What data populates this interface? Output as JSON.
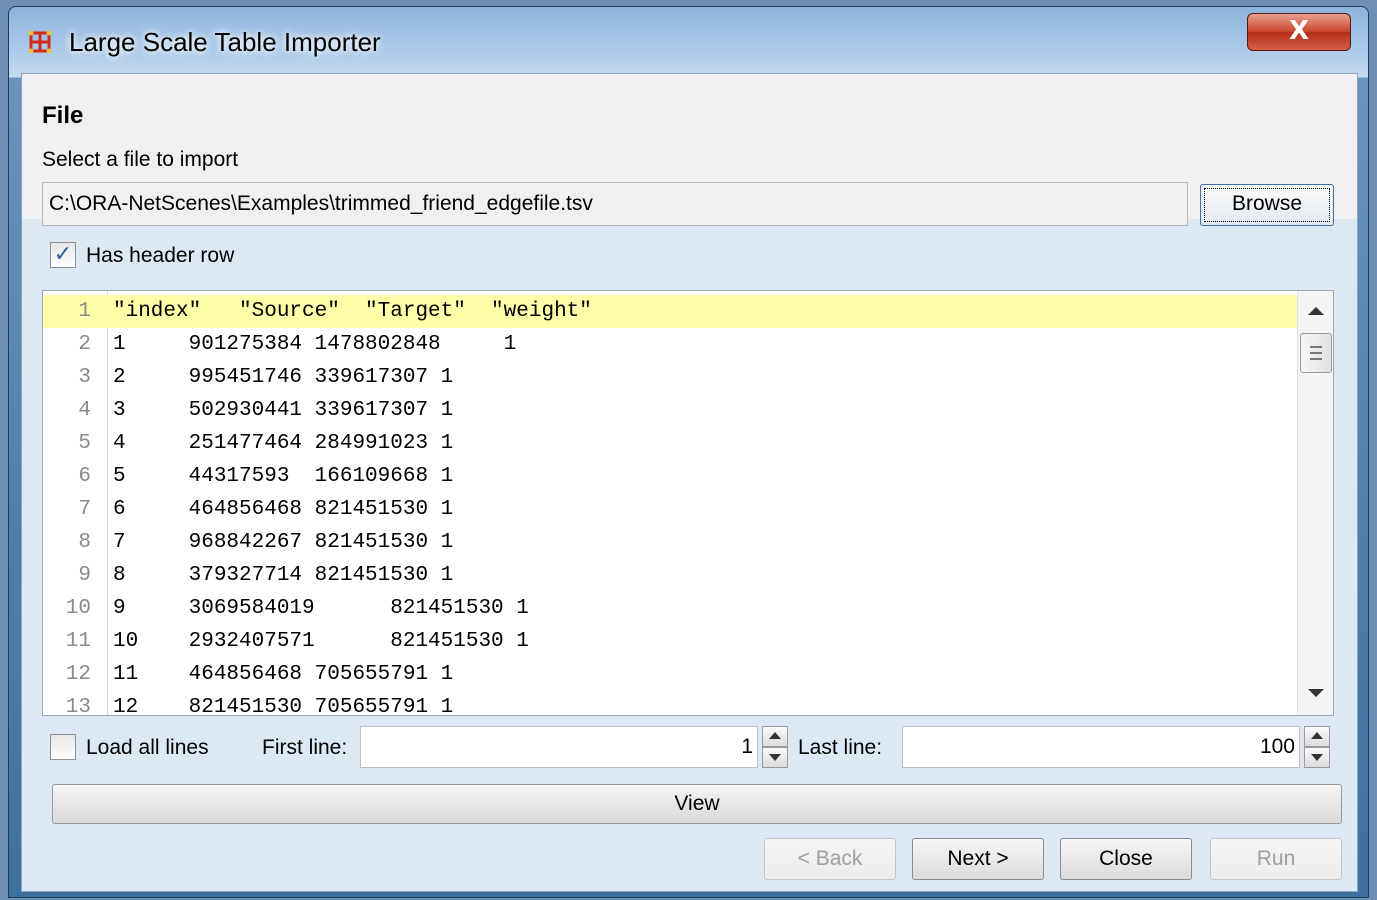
{
  "window": {
    "title": "Large Scale Table Importer",
    "close_glyph": "X",
    "app_icon": "network-grid-icon",
    "icon_color": "#d22a1c"
  },
  "file_section": {
    "title": "File",
    "subtitle": "Select a file to import",
    "path_value": "C:\\ORA-NetScenes\\Examples\\trimmed_friend_edgefile.tsv",
    "browse_label": "Browse",
    "has_header_label": "Has header row",
    "has_header_checked": true
  },
  "preview": {
    "lines": [
      {
        "n": "1",
        "text": "\"index\"   \"Source\"  \"Target\"  \"weight\""
      },
      {
        "n": "2",
        "text": "1     901275384 1478802848     1"
      },
      {
        "n": "3",
        "text": "2     995451746 339617307 1"
      },
      {
        "n": "4",
        "text": "3     502930441 339617307 1"
      },
      {
        "n": "5",
        "text": "4     251477464 284991023 1"
      },
      {
        "n": "6",
        "text": "5     44317593  166109668 1"
      },
      {
        "n": "7",
        "text": "6     464856468 821451530 1"
      },
      {
        "n": "8",
        "text": "7     968842267 821451530 1"
      },
      {
        "n": "9",
        "text": "8     379327714 821451530 1"
      },
      {
        "n": "10",
        "text": "9     3069584019      821451530 1"
      },
      {
        "n": "11",
        "text": "10    2932407571      821451530 1"
      },
      {
        "n": "12",
        "text": "11    464856468 705655791 1"
      },
      {
        "n": "13",
        "text": "12    821451530 705655791 1"
      }
    ],
    "highlight_color": "#ffffaa"
  },
  "range": {
    "load_all_label": "Load all lines",
    "load_all_checked": false,
    "first_line_label": "First line:",
    "first_line_value": "1",
    "last_line_label": "Last line:",
    "last_line_value": "100"
  },
  "buttons": {
    "view": "View",
    "back": "< Back",
    "next": "Next >",
    "close": "Close",
    "run": "Run"
  }
}
